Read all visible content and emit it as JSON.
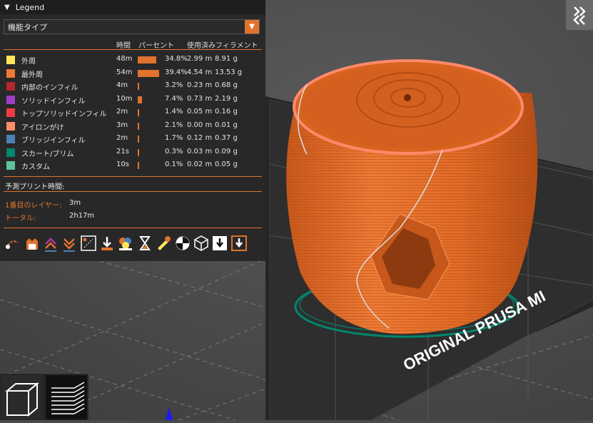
{
  "legend": {
    "title": "Legend",
    "feature_type": "機能タイプ",
    "columns": {
      "time": "時間",
      "percent": "パーセント",
      "filament": "使用済みフィラメント"
    },
    "rows": [
      {
        "name": "外周",
        "color": "#ffe65a",
        "time": "48m",
        "percent": "34.8%",
        "length": "2.99 m",
        "weight": "8.91 g",
        "fraction": 0.348
      },
      {
        "name": "最外周",
        "color": "#ee7a36",
        "time": "54m",
        "percent": "39.4%",
        "length": "4.54 m",
        "weight": "13.53 g",
        "fraction": 0.394
      },
      {
        "name": "内部のインフィル",
        "color": "#b2282c",
        "time": "4m",
        "percent": "3.2%",
        "length": "0.23 m",
        "weight": "0.68 g",
        "fraction": 0.032
      },
      {
        "name": "ソリッドインフィル",
        "color": "#9c3ec8",
        "time": "10m",
        "percent": "7.4%",
        "length": "0.73 m",
        "weight": "2.19 g",
        "fraction": 0.074
      },
      {
        "name": "トップソリッドインフィル",
        "color": "#f03c46",
        "time": "2m",
        "percent": "1.4%",
        "length": "0.05 m",
        "weight": "0.16 g",
        "fraction": 0.014
      },
      {
        "name": "アイロンがけ",
        "color": "#ff8c68",
        "time": "3m",
        "percent": "2.1%",
        "length": "0.00 m",
        "weight": "0.01 g",
        "fraction": 0.021
      },
      {
        "name": "ブリッジインフィル",
        "color": "#4c80b6",
        "time": "2m",
        "percent": "1.7%",
        "length": "0.12 m",
        "weight": "0.37 g",
        "fraction": 0.017
      },
      {
        "name": "スカート/ブリム",
        "color": "#00876e",
        "time": "21s",
        "percent": "0.3%",
        "length": "0.03 m",
        "weight": "0.09 g",
        "fraction": 0.003
      },
      {
        "name": "カスタム",
        "color": "#5ec39b",
        "time": "10s",
        "percent": "0.1%",
        "length": "0.02 m",
        "weight": "0.05 g",
        "fraction": 0.001
      }
    ],
    "estimated_time_label": "予測プリント時間:",
    "first_layer_label": "1番目のレイヤー:",
    "first_layer_value": "3m",
    "total_label": "トータル:",
    "total_value": "2h17m",
    "toolbar_icons": [
      "travel-icon",
      "retractions-icon",
      "deretractions-icon",
      "seams-icon",
      "color-changes-icon",
      "pause-prints-icon",
      "custom-gcodes-icon",
      "color-print-icon",
      "layer-time-icon",
      "tool-marker-icon",
      "shells-icon",
      "bounding-box-icon",
      "export-toolpaths-icon"
    ]
  },
  "bed_label": "ORIGINAL PRUSA MI",
  "accent_color": "#e0732e",
  "model_color": "#e8702a"
}
